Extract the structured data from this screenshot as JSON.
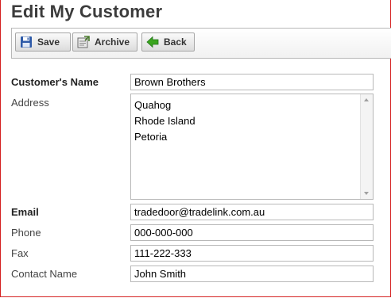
{
  "page": {
    "title": "Edit My Customer"
  },
  "toolbar": {
    "save_label": "Save",
    "archive_label": "Archive",
    "back_label": "Back"
  },
  "form": {
    "name_label": "Customer's Name",
    "name_value": "Brown Brothers",
    "address_label": "Address",
    "address_lines": [
      "Quahog",
      "Rhode Island",
      "Petoria"
    ],
    "email_label": "Email",
    "email_value": "tradedoor@tradelink.com.au",
    "phone_label": "Phone",
    "phone_value": "000-000-000",
    "fax_label": "Fax",
    "fax_value": "111-222-333",
    "contact_label": "Contact Name",
    "contact_value": "John Smith"
  },
  "icons": {
    "save": "floppy-disk-icon",
    "archive": "archive-icon",
    "back": "green-arrow-left-icon"
  },
  "colors": {
    "frame_border": "#d42020",
    "back_arrow": "#3aa51e"
  }
}
